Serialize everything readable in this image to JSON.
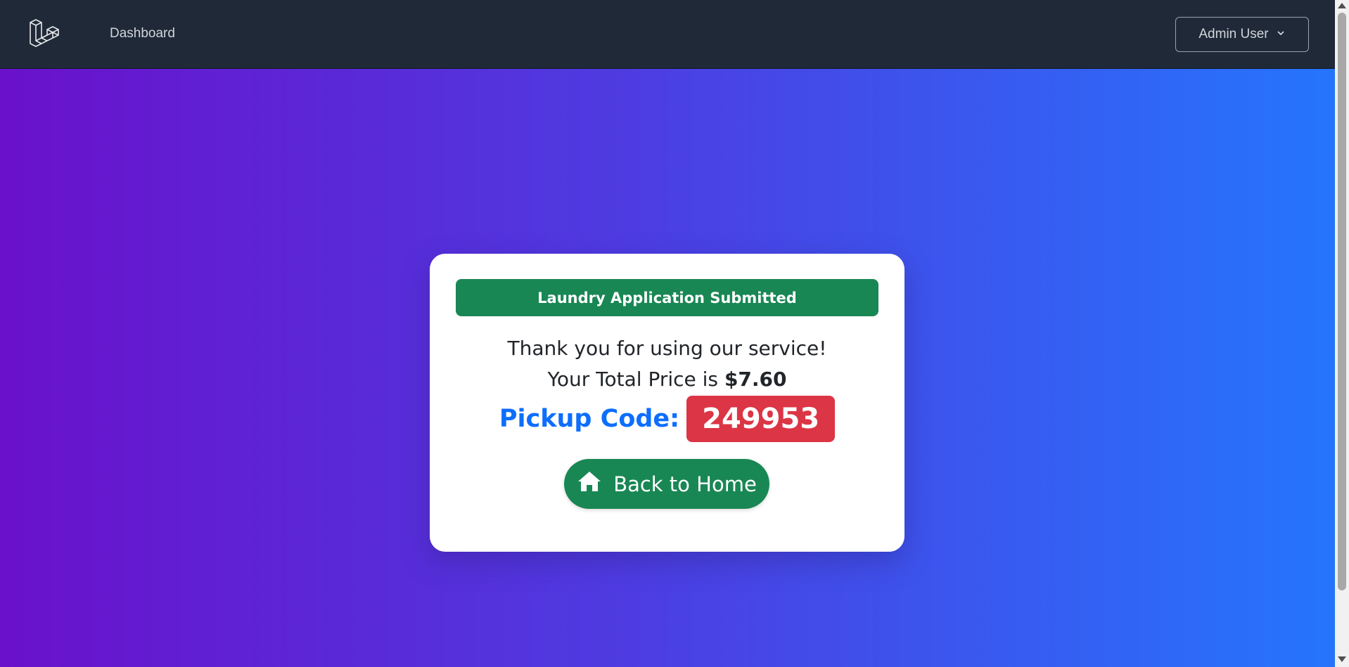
{
  "nav": {
    "logo_icon": "laravel-logo-icon",
    "dashboard_label": "Dashboard",
    "user_name": "Admin User",
    "user_menu_icon": "chevron-down-icon"
  },
  "card": {
    "alert_text": "Laundry Application Submitted",
    "thanks_text": "Thank you for using our service!",
    "price_prefix": "Your Total Price is",
    "price_value": "$7.60",
    "pickup_label": "Pickup Code:",
    "pickup_code": "249953",
    "home_button_label": "Back to Home",
    "home_button_icon": "home-icon"
  },
  "colors": {
    "nav_bg": "#1f2937",
    "gradient_start": "#6a11cb",
    "gradient_end": "#2575fc",
    "success": "#198754",
    "primary": "#0d6efd",
    "danger": "#dc3545"
  }
}
